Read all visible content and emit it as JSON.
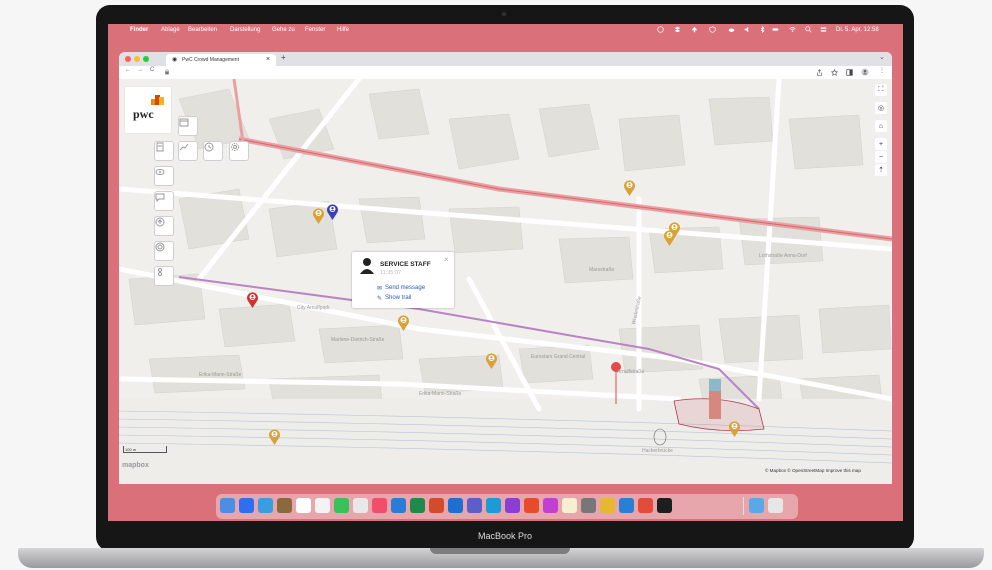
{
  "menubar": {
    "apple": "",
    "items": [
      "Finder",
      "Ablage",
      "Bearbeiten",
      "Darstellung",
      "Gehe zu",
      "Fenster",
      "Hilfe"
    ],
    "datetime": "Di. 5. Apr. 12:58"
  },
  "browser": {
    "tab_title": "PwC Crowd Management",
    "tab_close": "×",
    "new_tab": "+",
    "tab_menu": "⌄",
    "back": "←",
    "forward": "→",
    "reload": "C"
  },
  "map": {
    "logo_text": "pwc",
    "street_labels": {
      "marsstrasse": "Marsstraße",
      "arnulfstrasse": "Arnulfstraße",
      "erika_mann": "Erika-Mann-Straße",
      "wredestrasse": "Wredestraße",
      "hackerbruecke": "Hackerbrücke",
      "marie_dietrich": "Marlene-Dietrich-Straße",
      "loh_str": "Lothstraße Anna-Dorf",
      "erika_mann_left": "Erika-Mann-Straße",
      "eurostars": "Eurostars Grand Central",
      "city_arnulfpark": "City Arnulfpark"
    },
    "scale_label": "100 m",
    "attribution": "© Mapbox © OpenStreetMap  Improve this map",
    "mapbox_logo": "mapbox",
    "popup": {
      "title": "SERVICE STAFF",
      "time": "11:35:07",
      "close": "×",
      "send_message": "Send message",
      "show_trail": "Show trail"
    },
    "right_controls": [
      "⛶",
      "◎",
      "⌂",
      "+",
      "−",
      "⇡"
    ],
    "pin_colors": {
      "staff": "#d9a13a",
      "security": "#3b3fb6",
      "alert": "#c8352e",
      "dest": "#e34a4a"
    }
  },
  "device": {
    "label": "MacBook Pro"
  }
}
